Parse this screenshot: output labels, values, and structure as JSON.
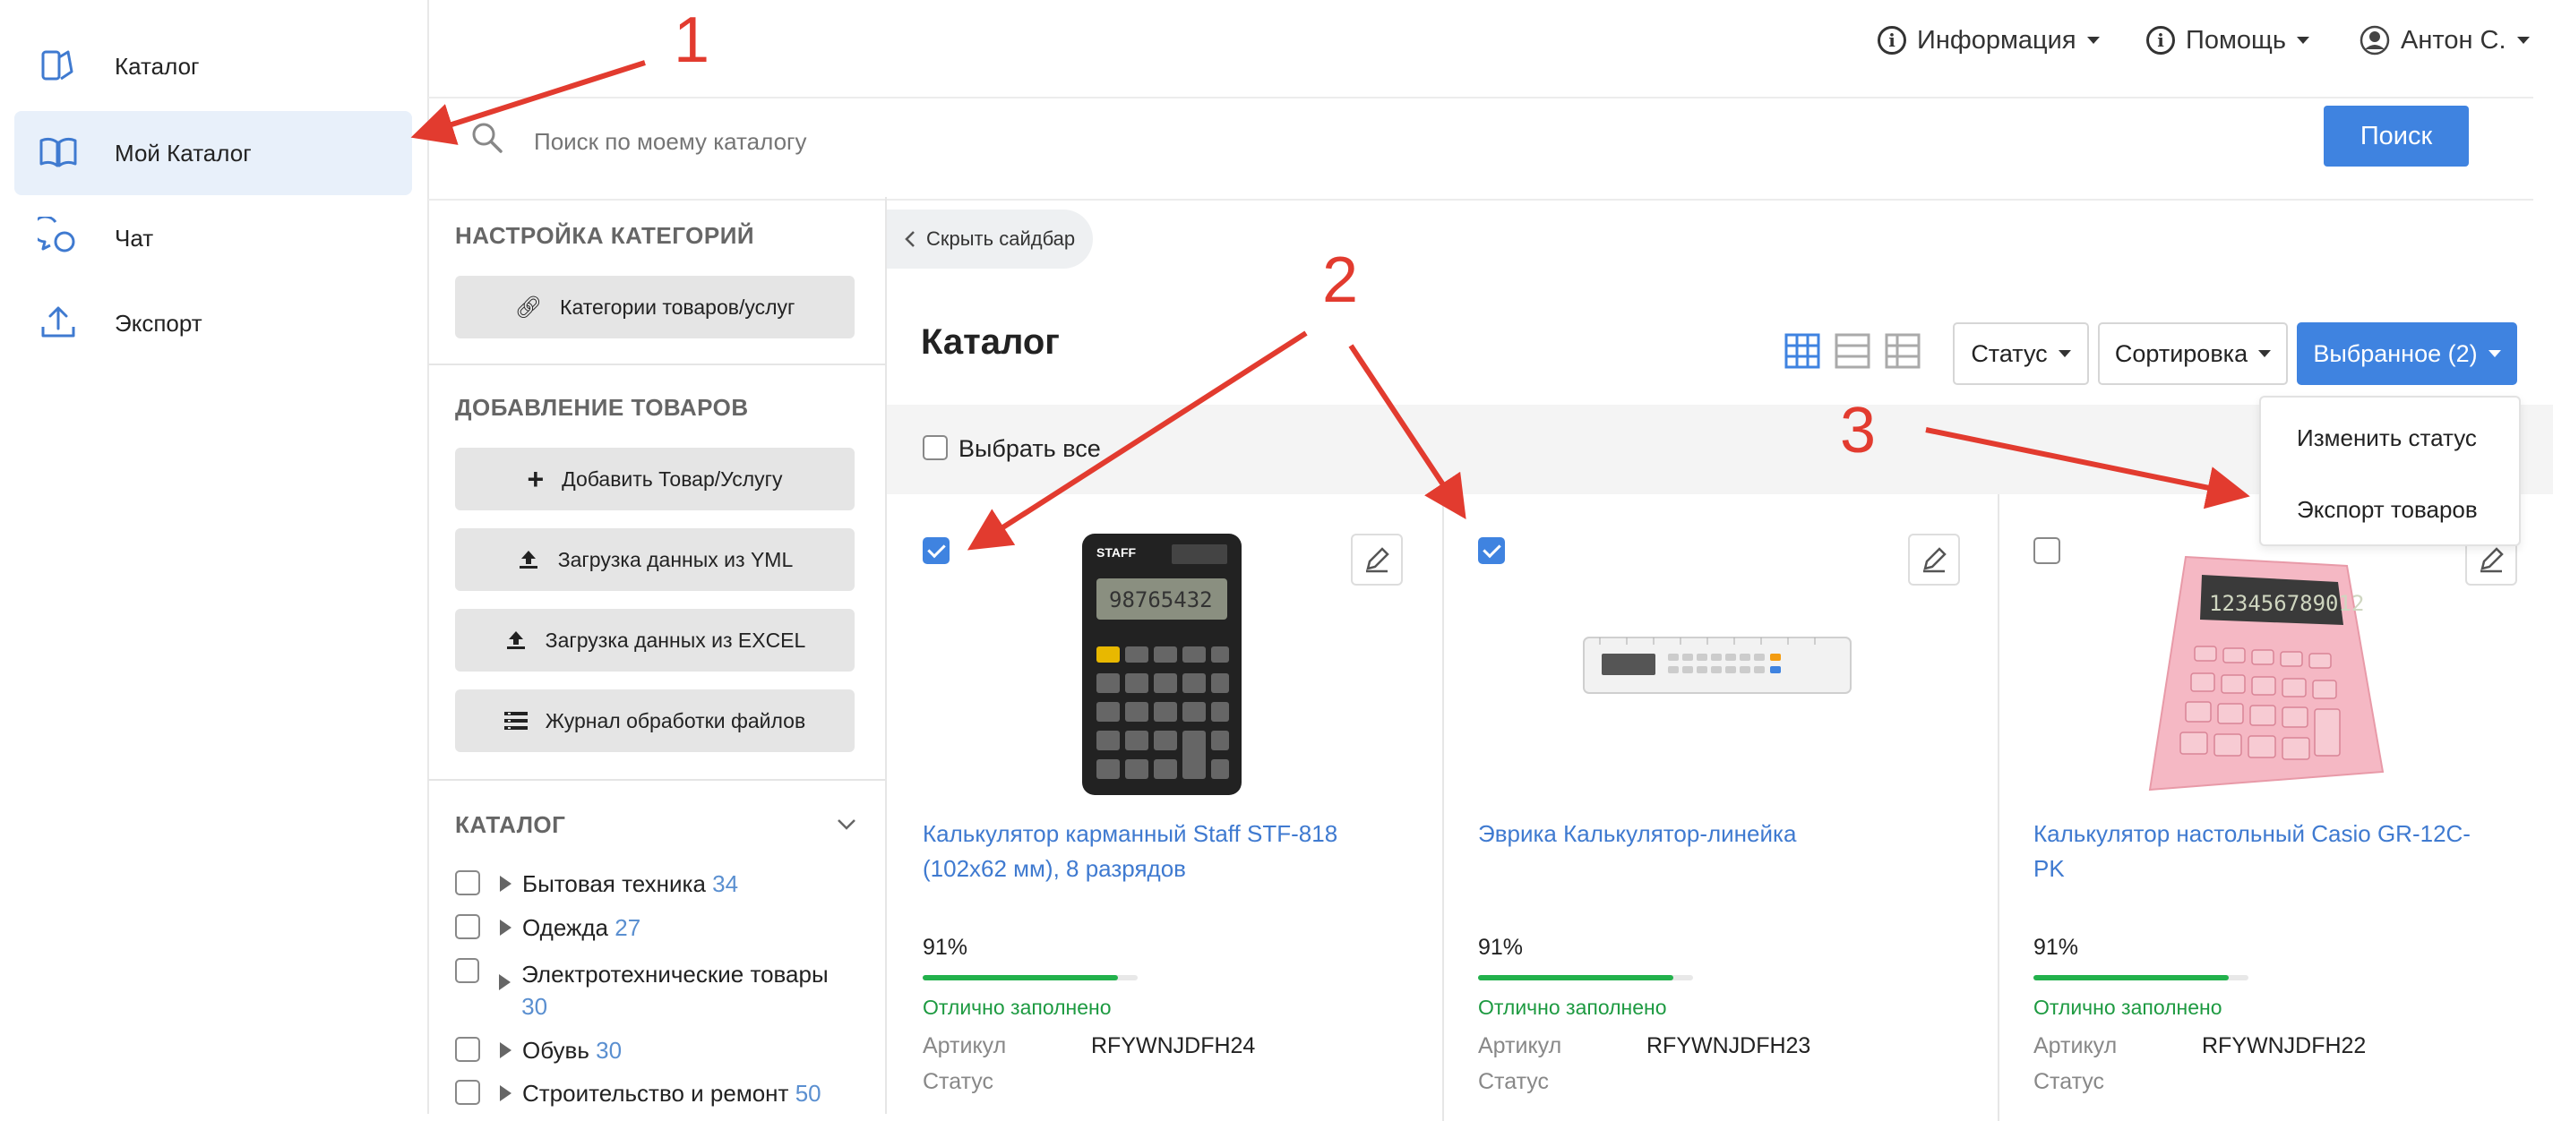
{
  "nav": {
    "items": [
      {
        "label": "Каталог",
        "icon": "catalog-icon"
      },
      {
        "label": "Мой Каталог",
        "icon": "book-icon"
      },
      {
        "label": "Чат",
        "icon": "chat-icon"
      },
      {
        "label": "Экспорт",
        "icon": "upload-icon"
      }
    ],
    "active_index": 1
  },
  "header": {
    "info": "Информация",
    "help": "Помощь",
    "user": "Антон С."
  },
  "search": {
    "placeholder": "Поиск по моему каталогу",
    "button": "Поиск"
  },
  "sidebar": {
    "categories_settings_title": "НАСТРОЙКА КАТЕГОРИЙ",
    "categories_button": "Категории товаров/услуг",
    "add_title": "ДОБАВЛЕНИЕ ТОВАРОВ",
    "add_buttons": [
      {
        "label": "Добавить Товар/Услугу",
        "icon": "plus-icon"
      },
      {
        "label": "Загрузка данных из YML",
        "icon": "upload-icon"
      },
      {
        "label": "Загрузка данных из EXCEL",
        "icon": "upload-icon"
      },
      {
        "label": "Журнал обработки файлов",
        "icon": "list-icon"
      }
    ],
    "catalog_title": "КАТАЛОГ",
    "catalog_items": [
      {
        "label": "Бытовая техника",
        "count": "34"
      },
      {
        "label": "Одежда",
        "count": "27"
      },
      {
        "label": "Электротехнические товары",
        "count": "30"
      },
      {
        "label": "Обувь",
        "count": "30"
      },
      {
        "label": "Строительство и ремонт",
        "count": "50"
      }
    ]
  },
  "main": {
    "hide_sidebar": "Скрыть сайдбар",
    "title": "Каталог",
    "status_btn": "Статус",
    "sort_btn": "Сортировка",
    "selected_btn": "Выбранное (2)",
    "select_all": "Выбрать все",
    "menu": [
      "Изменить статус",
      "Экспорт товаров"
    ],
    "products": [
      {
        "title": "Калькулятор карманный Staff STF-818 (102x62 мм), 8 разрядов",
        "percent": "91%",
        "fill": 0.91,
        "quality": "Отлично заполнено",
        "sku_label": "Артикул",
        "sku": "RFYWNJDFH24",
        "status_label": "Статус",
        "checked": true
      },
      {
        "title": "Эврика Калькулятор-линейка",
        "percent": "91%",
        "fill": 0.91,
        "quality": "Отлично заполнено",
        "sku_label": "Артикул",
        "sku": "RFYWNJDFH23",
        "status_label": "Статус",
        "checked": true
      },
      {
        "title": "Калькулятор настольный Casio GR-12C-PK",
        "percent": "91%",
        "fill": 0.91,
        "quality": "Отлично заполнено",
        "sku_label": "Артикул",
        "sku": "RFYWNJDFH22",
        "status_label": "Статус",
        "checked": false
      }
    ]
  },
  "annotations": {
    "a1": "1",
    "a2": "2",
    "a3": "3",
    "color": "#e23b2f"
  },
  "colors": {
    "accent": "#3f83e0",
    "link": "#3f7ad0",
    "success": "#1d9a41"
  }
}
